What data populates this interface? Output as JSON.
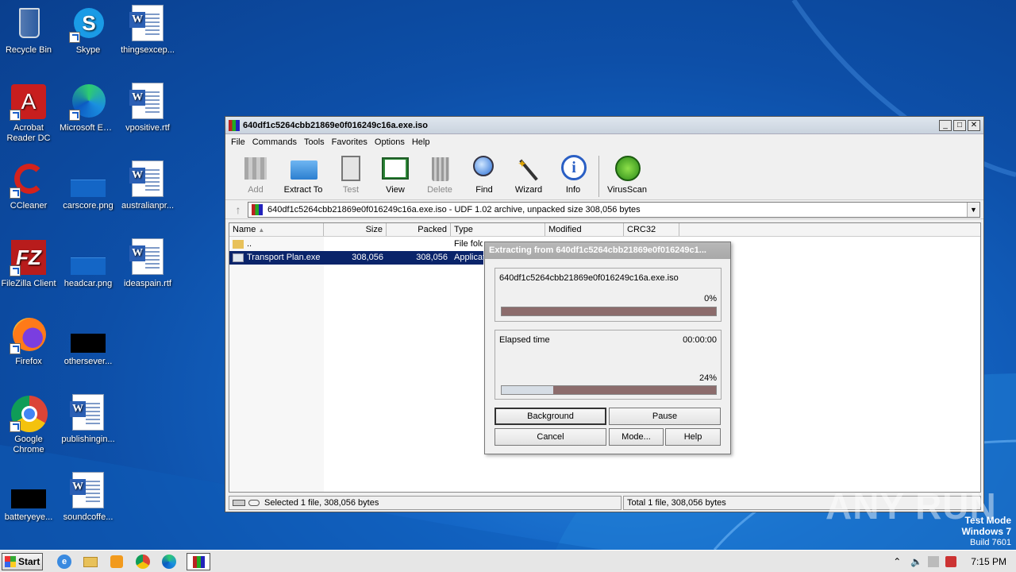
{
  "desktop": {
    "icons": [
      {
        "label": "Recycle Bin"
      },
      {
        "label": "Skype"
      },
      {
        "label": "thingsexcep..."
      },
      {
        "label": "Acrobat Reader DC"
      },
      {
        "label": "Microsoft Edge"
      },
      {
        "label": "vpositive.rtf"
      },
      {
        "label": "CCleaner"
      },
      {
        "label": "carscore.png"
      },
      {
        "label": "australianpr..."
      },
      {
        "label": "FileZilla Client"
      },
      {
        "label": "headcar.png"
      },
      {
        "label": "ideaspain.rtf"
      },
      {
        "label": "Firefox"
      },
      {
        "label": "othersever..."
      },
      {
        "label": "Google Chrome"
      },
      {
        "label": "publishingin..."
      },
      {
        "label": "batteryeye..."
      },
      {
        "label": "soundcoffe..."
      }
    ]
  },
  "window": {
    "title": "640df1c5264cbb21869e0f016249c16a.exe.iso",
    "menu": [
      "File",
      "Commands",
      "Tools",
      "Favorites",
      "Options",
      "Help"
    ],
    "toolbar": {
      "add": "Add",
      "extract_to": "Extract To",
      "test": "Test",
      "view": "View",
      "delete": "Delete",
      "find": "Find",
      "wizard": "Wizard",
      "info": "Info",
      "virusscan": "VirusScan"
    },
    "address": "640df1c5264cbb21869e0f016249c16a.exe.iso - UDF 1.02 archive, unpacked size 308,056 bytes",
    "columns": {
      "name": "Name",
      "size": "Size",
      "packed": "Packed",
      "type": "Type",
      "modified": "Modified",
      "crc32": "CRC32"
    },
    "rows": [
      {
        "name": "..",
        "size": "",
        "packed": "",
        "type": "File fold"
      },
      {
        "name": "Transport Plan.exe",
        "size": "308,056",
        "packed": "308,056",
        "type": "Applicat"
      }
    ],
    "status_left": "Selected 1 file, 308,056 bytes",
    "status_right": "Total 1 file, 308,056 bytes"
  },
  "dialog": {
    "title": "Extracting from 640df1c5264cbb21869e0f016249c1...",
    "archive": "640df1c5264cbb21869e0f016249c16a.exe.iso",
    "file_percent_label": "0%",
    "file_progress": 0,
    "elapsed_label": "Elapsed time",
    "elapsed": "00:00:00",
    "total_percent_label": "24%",
    "total_progress": 0.24,
    "buttons": {
      "background": "Background",
      "pause": "Pause",
      "cancel": "Cancel",
      "mode": "Mode...",
      "help": "Help"
    }
  },
  "taskbar": {
    "start": "Start",
    "clock": "7:15 PM"
  },
  "watermark": "ANY RUN",
  "testmode": {
    "line1": "Test Mode",
    "line2": "Windows 7",
    "line3": "Build 7601"
  }
}
